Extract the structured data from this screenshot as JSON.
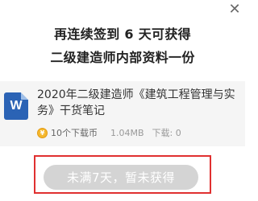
{
  "dialog": {
    "close_icon": "close-icon",
    "headline_line1": "再连续签到 6 天可获得",
    "headline_line2": "二级建造师内部资料一份"
  },
  "document": {
    "icon": "word-doc-icon",
    "icon_letter": "W",
    "title": "2020年二级建造师《建筑工程管理与实务》干货笔记",
    "coins_label": "10个下载币",
    "size": "1.04MB",
    "downloads_label": "下载: 0"
  },
  "action": {
    "button_label": "未满7天，暂未获得"
  },
  "colors": {
    "button_bg": "#d4d4d4",
    "highlight": "#e03030",
    "doc_icon": "#2b63b5",
    "coin": "#f5b82e"
  }
}
